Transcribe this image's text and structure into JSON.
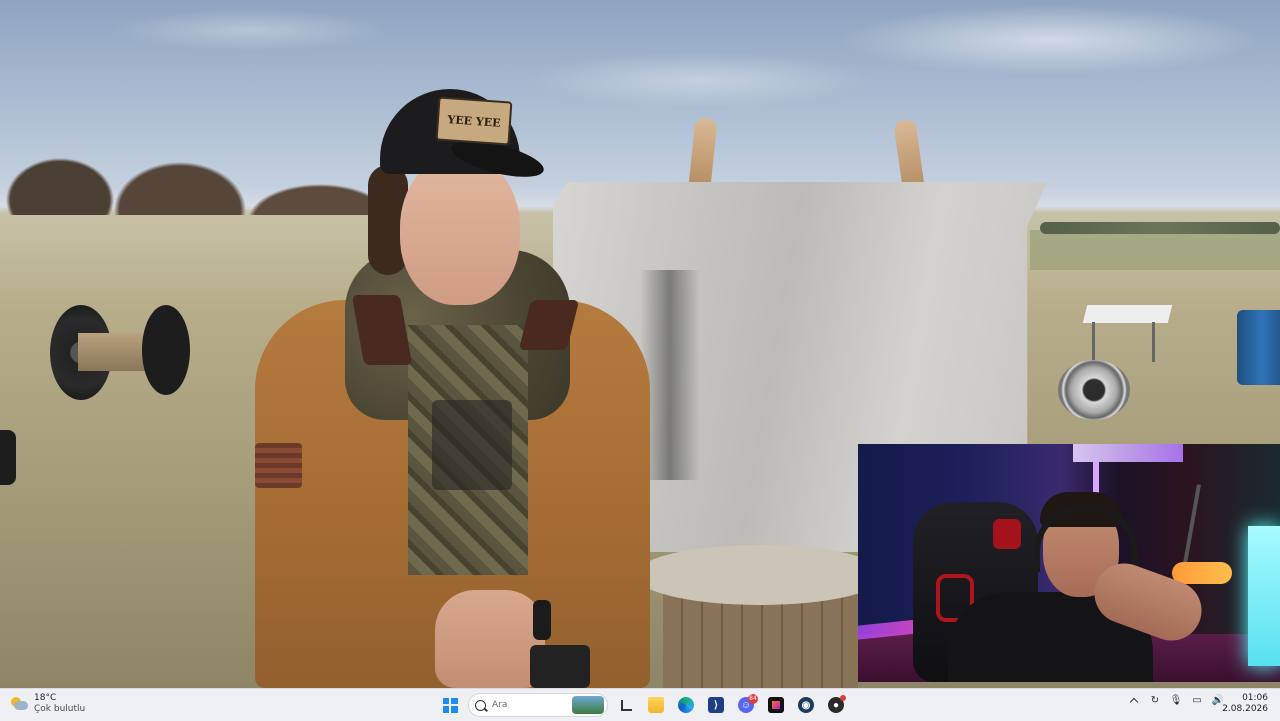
{
  "video": {
    "cap_text": "YEE YEE"
  },
  "taskbar": {
    "weather": {
      "temp": "18°C",
      "desc": "Çok bulutlu",
      "icon": "partly-cloudy-icon"
    },
    "search": {
      "placeholder": "Ara"
    },
    "apps": [
      {
        "name": "task-view",
        "icon": "task-view-icon"
      },
      {
        "name": "file-explorer",
        "icon": "folder-icon"
      },
      {
        "name": "edge",
        "icon": "edge-icon"
      },
      {
        "name": "visual-studio",
        "icon": "vs-icon"
      },
      {
        "name": "discord",
        "icon": "discord-icon",
        "badge": "84"
      },
      {
        "name": "jetbrains",
        "icon": "jetbrains-icon"
      },
      {
        "name": "steam",
        "icon": "steam-icon"
      },
      {
        "name": "github",
        "icon": "github-icon"
      }
    ],
    "clock": {
      "time": "01:06",
      "date": "2.08.2026"
    }
  }
}
